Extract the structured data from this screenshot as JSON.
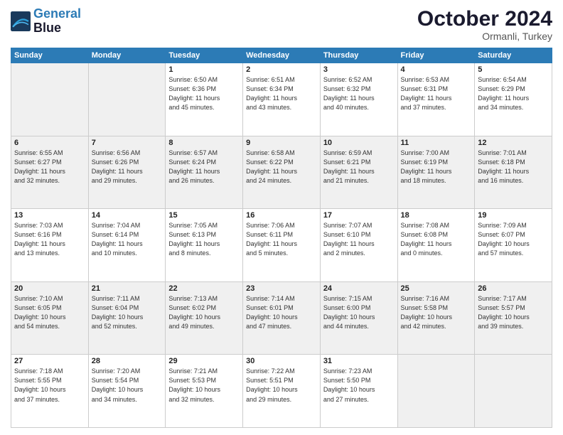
{
  "header": {
    "logo_line1": "General",
    "logo_line2": "Blue",
    "month": "October 2024",
    "location": "Ormanli, Turkey"
  },
  "weekdays": [
    "Sunday",
    "Monday",
    "Tuesday",
    "Wednesday",
    "Thursday",
    "Friday",
    "Saturday"
  ],
  "weeks": [
    [
      {
        "day": "",
        "info": ""
      },
      {
        "day": "",
        "info": ""
      },
      {
        "day": "1",
        "info": "Sunrise: 6:50 AM\nSunset: 6:36 PM\nDaylight: 11 hours\nand 45 minutes."
      },
      {
        "day": "2",
        "info": "Sunrise: 6:51 AM\nSunset: 6:34 PM\nDaylight: 11 hours\nand 43 minutes."
      },
      {
        "day": "3",
        "info": "Sunrise: 6:52 AM\nSunset: 6:32 PM\nDaylight: 11 hours\nand 40 minutes."
      },
      {
        "day": "4",
        "info": "Sunrise: 6:53 AM\nSunset: 6:31 PM\nDaylight: 11 hours\nand 37 minutes."
      },
      {
        "day": "5",
        "info": "Sunrise: 6:54 AM\nSunset: 6:29 PM\nDaylight: 11 hours\nand 34 minutes."
      }
    ],
    [
      {
        "day": "6",
        "info": "Sunrise: 6:55 AM\nSunset: 6:27 PM\nDaylight: 11 hours\nand 32 minutes."
      },
      {
        "day": "7",
        "info": "Sunrise: 6:56 AM\nSunset: 6:26 PM\nDaylight: 11 hours\nand 29 minutes."
      },
      {
        "day": "8",
        "info": "Sunrise: 6:57 AM\nSunset: 6:24 PM\nDaylight: 11 hours\nand 26 minutes."
      },
      {
        "day": "9",
        "info": "Sunrise: 6:58 AM\nSunset: 6:22 PM\nDaylight: 11 hours\nand 24 minutes."
      },
      {
        "day": "10",
        "info": "Sunrise: 6:59 AM\nSunset: 6:21 PM\nDaylight: 11 hours\nand 21 minutes."
      },
      {
        "day": "11",
        "info": "Sunrise: 7:00 AM\nSunset: 6:19 PM\nDaylight: 11 hours\nand 18 minutes."
      },
      {
        "day": "12",
        "info": "Sunrise: 7:01 AM\nSunset: 6:18 PM\nDaylight: 11 hours\nand 16 minutes."
      }
    ],
    [
      {
        "day": "13",
        "info": "Sunrise: 7:03 AM\nSunset: 6:16 PM\nDaylight: 11 hours\nand 13 minutes."
      },
      {
        "day": "14",
        "info": "Sunrise: 7:04 AM\nSunset: 6:14 PM\nDaylight: 11 hours\nand 10 minutes."
      },
      {
        "day": "15",
        "info": "Sunrise: 7:05 AM\nSunset: 6:13 PM\nDaylight: 11 hours\nand 8 minutes."
      },
      {
        "day": "16",
        "info": "Sunrise: 7:06 AM\nSunset: 6:11 PM\nDaylight: 11 hours\nand 5 minutes."
      },
      {
        "day": "17",
        "info": "Sunrise: 7:07 AM\nSunset: 6:10 PM\nDaylight: 11 hours\nand 2 minutes."
      },
      {
        "day": "18",
        "info": "Sunrise: 7:08 AM\nSunset: 6:08 PM\nDaylight: 11 hours\nand 0 minutes."
      },
      {
        "day": "19",
        "info": "Sunrise: 7:09 AM\nSunset: 6:07 PM\nDaylight: 10 hours\nand 57 minutes."
      }
    ],
    [
      {
        "day": "20",
        "info": "Sunrise: 7:10 AM\nSunset: 6:05 PM\nDaylight: 10 hours\nand 54 minutes."
      },
      {
        "day": "21",
        "info": "Sunrise: 7:11 AM\nSunset: 6:04 PM\nDaylight: 10 hours\nand 52 minutes."
      },
      {
        "day": "22",
        "info": "Sunrise: 7:13 AM\nSunset: 6:02 PM\nDaylight: 10 hours\nand 49 minutes."
      },
      {
        "day": "23",
        "info": "Sunrise: 7:14 AM\nSunset: 6:01 PM\nDaylight: 10 hours\nand 47 minutes."
      },
      {
        "day": "24",
        "info": "Sunrise: 7:15 AM\nSunset: 6:00 PM\nDaylight: 10 hours\nand 44 minutes."
      },
      {
        "day": "25",
        "info": "Sunrise: 7:16 AM\nSunset: 5:58 PM\nDaylight: 10 hours\nand 42 minutes."
      },
      {
        "day": "26",
        "info": "Sunrise: 7:17 AM\nSunset: 5:57 PM\nDaylight: 10 hours\nand 39 minutes."
      }
    ],
    [
      {
        "day": "27",
        "info": "Sunrise: 7:18 AM\nSunset: 5:55 PM\nDaylight: 10 hours\nand 37 minutes."
      },
      {
        "day": "28",
        "info": "Sunrise: 7:20 AM\nSunset: 5:54 PM\nDaylight: 10 hours\nand 34 minutes."
      },
      {
        "day": "29",
        "info": "Sunrise: 7:21 AM\nSunset: 5:53 PM\nDaylight: 10 hours\nand 32 minutes."
      },
      {
        "day": "30",
        "info": "Sunrise: 7:22 AM\nSunset: 5:51 PM\nDaylight: 10 hours\nand 29 minutes."
      },
      {
        "day": "31",
        "info": "Sunrise: 7:23 AM\nSunset: 5:50 PM\nDaylight: 10 hours\nand 27 minutes."
      },
      {
        "day": "",
        "info": ""
      },
      {
        "day": "",
        "info": ""
      }
    ]
  ]
}
